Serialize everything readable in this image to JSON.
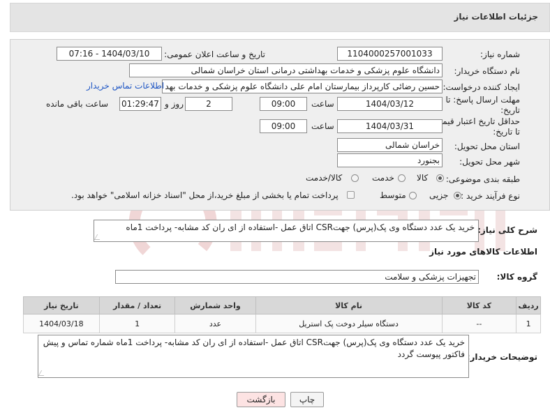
{
  "header": {
    "title": "جزئیات اطلاعات نیاز"
  },
  "form": {
    "need_number_label": "شماره نیاز:",
    "need_number": "1104000257001033",
    "announce_label": "تاریخ و ساعت اعلان عمومی:",
    "announce_value": "1404/03/10 - 07:16",
    "buyer_org_label": "نام دستگاه خریدار:",
    "buyer_org": "دانشگاه علوم پزشکی و خدمات بهداشتی درمانی استان خراسان شمالی",
    "creator_label": "ایجاد کننده درخواست:",
    "creator": "حسین رضائی کارپرداز بیمارستان امام علی دانشگاه علوم پزشکی و خدمات بهد",
    "contact_link": "اطلاعات تماس خریدار",
    "deadline_label_1": "مهلت ارسال پاسخ: تا",
    "deadline_label_2": "تاریخ:",
    "deadline_date": "1404/03/12",
    "time_label": "ساعت",
    "deadline_time": "09:00",
    "days_value": "2",
    "days_label": "روز و",
    "remaining_time": "01:29:47",
    "remaining_label": "ساعت باقی مانده",
    "validity_label_1": "حداقل تاریخ اعتبار قیمت:",
    "validity_label_2": "تا تاریخ:",
    "validity_date": "1404/03/31",
    "validity_time": "09:00",
    "province_label": "استان محل تحویل:",
    "province": "خراسان شمالی",
    "city_label": "شهر محل تحویل:",
    "city": "بجنورد",
    "category_label": "طبقه بندی موضوعی:",
    "category_options": [
      "کالا",
      "خدمت",
      "کالا/خدمت"
    ],
    "category_selected": 0,
    "process_label": "نوع فرآیند خرید :",
    "process_options": [
      "جزیی",
      "متوسط"
    ],
    "process_selected": 0,
    "payment_note": "پرداخت تمام یا بخشی از مبلغ خرید،از محل \"اسناد خزانه اسلامی\" خواهد بود."
  },
  "description": {
    "label": "شرح کلی نیاز:",
    "text": "خرید یک عدد دستگاه وی پک(پرس)  جهتCSR اتاق عمل -استفاده از ای ران کد مشابه- پرداخت 1ماه"
  },
  "goods": {
    "section_title": "اطلاعات کالاهای مورد نیاز",
    "group_label": "گروه کالا:",
    "group_value": "تجهیزات پزشکی و سلامت",
    "columns": [
      "ردیف",
      "کد کالا",
      "نام کالا",
      "واحد شمارش",
      "تعداد / مقدار",
      "تاریخ نیاز"
    ],
    "rows": [
      [
        "1",
        "--",
        "دستگاه سیلر دوخت پک استریل",
        "عدد",
        "1",
        "1404/03/18"
      ]
    ]
  },
  "buyer_notes": {
    "label": "توضیحات خریدار:",
    "text": "خرید یک عدد دستگاه وی پک(پرس)  جهتCSR اتاق عمل -استفاده از ای ران کد مشابه- پرداخت 1ماه شماره تماس و پیش فاکتور پیوست گردد"
  },
  "buttons": {
    "print": "چاپ",
    "back": "بازگشت"
  },
  "colors": {
    "link": "#1f56c4",
    "header_bg": "#e4e4e4",
    "back_button_bg": "#fde3e3"
  }
}
